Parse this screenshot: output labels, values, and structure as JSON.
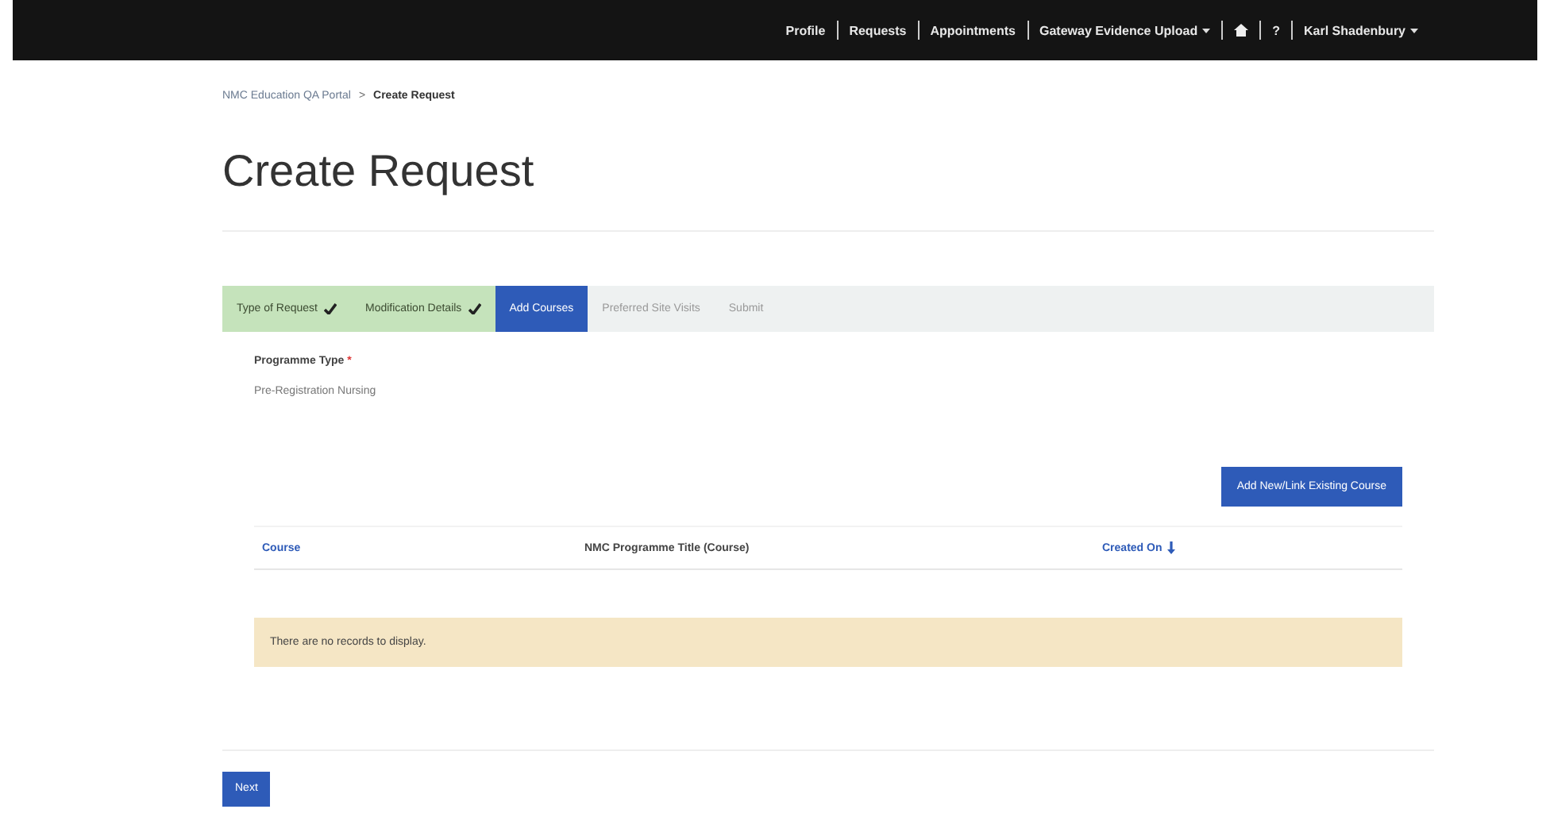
{
  "navbar": {
    "items": [
      {
        "kind": "link",
        "label": "Profile",
        "dropdown": false
      },
      {
        "kind": "link",
        "label": "Requests",
        "dropdown": false
      },
      {
        "kind": "link",
        "label": "Appointments",
        "dropdown": false
      },
      {
        "kind": "link",
        "label": "Gateway Evidence Upload",
        "dropdown": true
      },
      {
        "kind": "home"
      },
      {
        "kind": "link",
        "label": "?",
        "dropdown": false
      },
      {
        "kind": "link",
        "label": "Karl Shadenbury",
        "dropdown": true
      }
    ]
  },
  "breadcrumb": [
    {
      "label": "NMC Education QA Portal",
      "current": false
    },
    {
      "label": "Create Request",
      "current": true
    }
  ],
  "breadcrumb_separator": ">",
  "title": "Create Request",
  "steps": [
    {
      "label": "Type of Request",
      "completed": true,
      "selected": false
    },
    {
      "label": "Modification Details",
      "completed": true,
      "selected": false
    },
    {
      "label": "Add Courses",
      "completed": false,
      "selected": true
    },
    {
      "label": "Preferred Site Visits",
      "completed": false,
      "selected": false
    },
    {
      "label": "Submit",
      "completed": false,
      "selected": false
    }
  ],
  "field": {
    "label": "Programme Type",
    "required_mark": "*",
    "value": "Pre-Registration Nursing"
  },
  "add_button": "Add New/Link Existing Course",
  "table": {
    "columns": [
      {
        "label": "Course",
        "sortable": true,
        "sorted": false
      },
      {
        "label": "NMC Programme Title (Course)",
        "sortable": false,
        "sorted": false
      },
      {
        "label": "Created On",
        "sortable": true,
        "sorted": true
      }
    ],
    "empty_message": "There are no records to display."
  },
  "next_button": "Next"
}
